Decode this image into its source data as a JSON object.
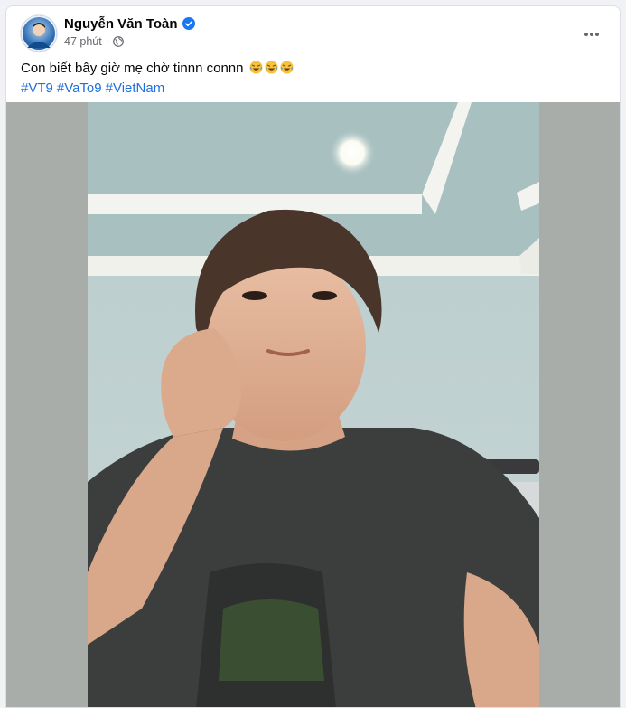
{
  "post": {
    "author": {
      "name": "Nguyễn Văn Toàn",
      "avatar_icon": "profile-avatar",
      "verified_icon": "verified-badge-icon"
    },
    "timestamp": "47 phút",
    "separator": "·",
    "audience_icon": "globe-icon",
    "more_icon": "more-horizontal-icon",
    "text": "Con biết bây giờ mẹ chờ tinnn connn",
    "emojis": [
      "tears-of-joy-emoji",
      "tears-of-joy-emoji",
      "tears-of-joy-emoji"
    ],
    "hashtags": [
      "#VT9",
      "#VaTo9",
      "#VietNam"
    ],
    "photo_icon": "selfie-photo"
  },
  "colors": {
    "accent": "#216fdb",
    "verified": "#1877f2",
    "text_primary": "#050505",
    "text_secondary": "#65676b",
    "media_backdrop": "#a8adaa"
  }
}
